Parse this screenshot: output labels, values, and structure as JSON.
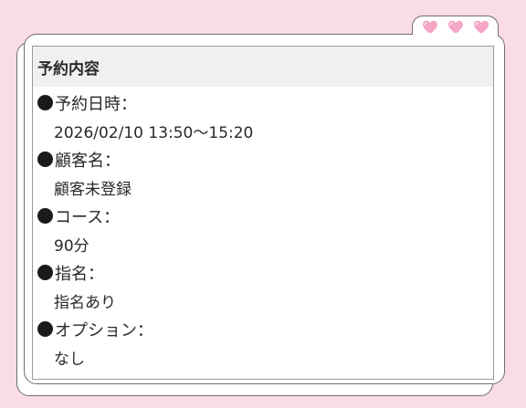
{
  "card": {
    "title": "予約内容",
    "fields": [
      {
        "label": "予約日時：",
        "value": "2026/02/10 13:50〜15:20"
      },
      {
        "label": "顧客名：",
        "value": "顧客未登録"
      },
      {
        "label": "コース：",
        "value": "90分"
      },
      {
        "label": "指名：",
        "value": "指名あり"
      },
      {
        "label": "オプション：",
        "value": "なし"
      }
    ]
  },
  "decor": {
    "heart_icon": "heart-icon",
    "heart_color": "#f6a6c6",
    "background_color": "#fadbe8"
  }
}
